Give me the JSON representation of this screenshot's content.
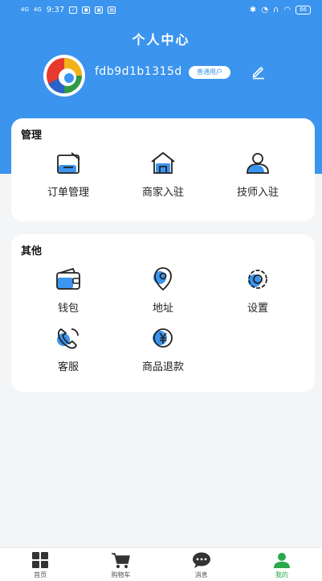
{
  "status_bar": {
    "signal_1": "4G",
    "signal_2": "4G",
    "time": "9:37",
    "battery": "66"
  },
  "header": {
    "title": "个人中心",
    "username": "fdb9d1b1315d",
    "user_badge": "普通用户",
    "edit_icon": "pencil-icon"
  },
  "management": {
    "title": "管理",
    "items": [
      {
        "label": "订单管理",
        "icon": "order-icon"
      },
      {
        "label": "商家入驻",
        "icon": "shop-icon"
      },
      {
        "label": "技师入驻",
        "icon": "technician-icon"
      }
    ]
  },
  "other": {
    "title": "其他",
    "items": [
      {
        "label": "钱包",
        "icon": "wallet-icon"
      },
      {
        "label": "地址",
        "icon": "location-icon"
      },
      {
        "label": "设置",
        "icon": "gear-icon"
      },
      {
        "label": "客服",
        "icon": "phone-icon"
      },
      {
        "label": "商品退款",
        "icon": "refund-icon"
      }
    ]
  },
  "bottom_nav": {
    "items": [
      {
        "label": "首页",
        "icon": "home-grid-icon"
      },
      {
        "label": "购物车",
        "icon": "cart-icon"
      },
      {
        "label": "消息",
        "icon": "chat-icon"
      },
      {
        "label": "我的",
        "icon": "profile-icon",
        "active": true
      }
    ]
  },
  "colors": {
    "primary": "#3b94ee",
    "active_nav": "#2aa84a",
    "background": "#f4f5f7"
  }
}
